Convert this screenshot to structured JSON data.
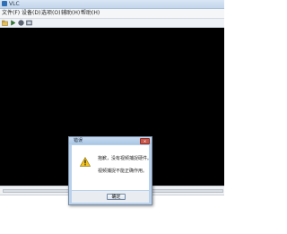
{
  "window": {
    "title": "VLC"
  },
  "menubar": {
    "items": [
      {
        "label": "文件(F)"
      },
      {
        "label": "设备(D)"
      },
      {
        "label": "选项(O)"
      },
      {
        "label": "辅助(H)"
      },
      {
        "label": "帮助(H)"
      }
    ]
  },
  "toolbar": {
    "icons": [
      "open-icon",
      "play-icon",
      "record-icon",
      "settings-icon"
    ]
  },
  "dialog": {
    "title": "错误",
    "close_label": "✕",
    "message_line1": "抱歉，没有视频捕捉硬件。",
    "message_line2": "视频捕捉不能正确作用。",
    "ok_label": "确定",
    "icon": "warning-icon"
  },
  "colors": {
    "video_background": "#000000",
    "dialog_accent": "#b9d1ea",
    "warning_yellow": "#f2c318"
  }
}
